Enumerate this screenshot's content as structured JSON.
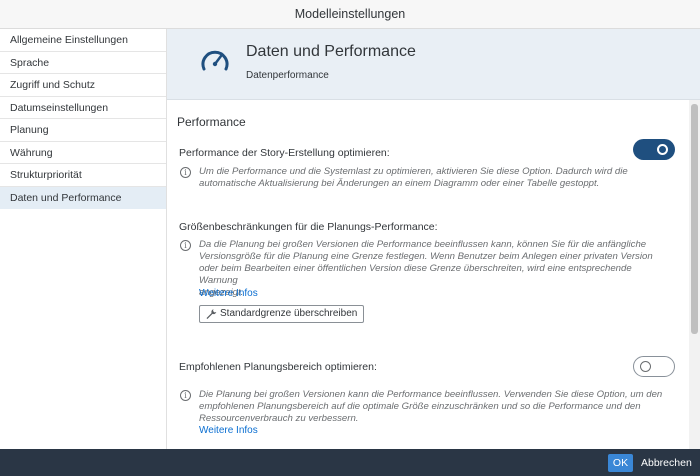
{
  "dialog": {
    "title": "Modelleinstellungen"
  },
  "sidebar": {
    "items": [
      {
        "label": "Allgemeine Einstellungen"
      },
      {
        "label": "Sprache"
      },
      {
        "label": "Zugriff und Schutz"
      },
      {
        "label": "Datumseinstellungen"
      },
      {
        "label": "Planung"
      },
      {
        "label": "Währung"
      },
      {
        "label": "Strukturpriorität"
      },
      {
        "label": "Daten und Performance"
      }
    ],
    "active_index": 7
  },
  "header": {
    "icon": "speedometer-icon",
    "title": "Daten und Performance",
    "subtitle": "Datenperformance"
  },
  "content": {
    "section_title": "Performance",
    "story_perf": {
      "label": "Performance der Story-Erstellung optimieren:",
      "toggle": "on",
      "desc_line1": "Um die Performance und die Systemlast zu optimieren, aktivieren Sie diese Option. Dadurch wird die",
      "desc_line2": "automatische Aktualisierung bei Änderungen an einem Diagramm oder einer Tabelle gestoppt."
    },
    "size_limits": {
      "label": "Größenbeschränkungen für die Planungs-Performance:",
      "desc_line1": "Da die Planung bei großen Versionen die Performance beeinflussen kann, können Sie für die anfängliche",
      "desc_line2": "Versionsgröße für die Planung eine Grenze festlegen. Wenn Benutzer beim Anlegen einer privaten Version",
      "desc_line3": "oder beim Bearbeiten einer öffentlichen Version diese Grenze überschreiten, wird eine entsprechende Warnung",
      "desc_line4": "angezeigt.",
      "link": "Weitere Infos",
      "button": "Standardgrenze überschreiben"
    },
    "planning_area": {
      "label": "Empfohlenen Planungsbereich optimieren:",
      "toggle": "off",
      "desc_line1": "Die Planung bei großen Versionen kann die Performance beeinflussen. Verwenden Sie diese Option, um den",
      "desc_line2": "empfohlenen Planungsbereich auf die optimale Größe einzuschränken und so die Performance und den",
      "desc_line3": "Ressourcenverbrauch zu verbessern.",
      "link": "Weitere Infos"
    }
  },
  "footer": {
    "ok": "OK",
    "cancel": "Abbrechen"
  },
  "colors": {
    "accent": "#1f4f7f",
    "footer": "#2a3645",
    "link": "#0a6ed1",
    "header_bg": "#e9eff5",
    "active_item": "#e4edf5"
  }
}
